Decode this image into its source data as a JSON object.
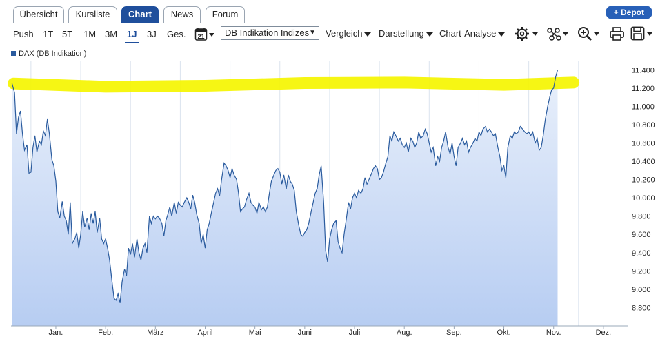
{
  "tabs": [
    {
      "label": "Übersicht"
    },
    {
      "label": "Kursliste"
    },
    {
      "label": "Chart"
    },
    {
      "label": "News"
    },
    {
      "label": "Forum"
    }
  ],
  "depot_button": "+ Depot",
  "periods": [
    "Push",
    "1T",
    "5T",
    "1M",
    "3M",
    "1J",
    "3J",
    "Ges."
  ],
  "active_period": "1J",
  "calendar_day": "21",
  "index_select": "DB Indikation Indizes",
  "menus": [
    "Vergleich",
    "Darstellung",
    "Chart-Analyse"
  ],
  "icons": [
    "gear-icon",
    "network-icon",
    "zoom-in-icon",
    "print-icon",
    "save-icon"
  ],
  "colors": {
    "accent": "#1f4f9c",
    "line": "#2a5b9e",
    "fill_top": "#e7eefb",
    "fill_bottom": "#b9cff3",
    "highlight": "#f5f500"
  },
  "chart_data": {
    "type": "area",
    "series": [
      {
        "name": "DAX (DB Indikation)"
      }
    ],
    "x_ticks": [
      "Jan.",
      "Feb.",
      "März",
      "April",
      "Mai",
      "Juni",
      "Juli",
      "Aug.",
      "Sep.",
      "Okt.",
      "Nov.",
      "Dez."
    ],
    "y_ticks": [
      "8.800",
      "9.000",
      "9.200",
      "9.400",
      "9.600",
      "9.800",
      "10.000",
      "10.200",
      "10.400",
      "10.600",
      "10.800",
      "11.000",
      "11.200",
      "11.400"
    ],
    "ylim": [
      8600,
      11500
    ],
    "grid": "vertical",
    "x_range_months": [
      -0.9,
      11.5
    ],
    "points": [
      [
        -0.88,
        11.25
      ],
      [
        -0.83,
        11.15
      ],
      [
        -0.79,
        10.7
      ],
      [
        -0.75,
        10.88
      ],
      [
        -0.71,
        10.95
      ],
      [
        -0.67,
        10.7
      ],
      [
        -0.63,
        10.52
      ],
      [
        -0.58,
        10.58
      ],
      [
        -0.54,
        10.27
      ],
      [
        -0.5,
        10.28
      ],
      [
        -0.46,
        10.55
      ],
      [
        -0.42,
        10.68
      ],
      [
        -0.38,
        10.5
      ],
      [
        -0.33,
        10.62
      ],
      [
        -0.29,
        10.58
      ],
      [
        -0.25,
        10.73
      ],
      [
        -0.21,
        10.68
      ],
      [
        -0.17,
        10.86
      ],
      [
        -0.13,
        10.7
      ],
      [
        -0.08,
        10.42
      ],
      [
        -0.04,
        10.35
      ],
      [
        0.0,
        10.18
      ],
      [
        0.04,
        9.85
      ],
      [
        0.08,
        9.78
      ],
      [
        0.13,
        9.96
      ],
      [
        0.17,
        9.8
      ],
      [
        0.21,
        9.75
      ],
      [
        0.25,
        9.6
      ],
      [
        0.29,
        9.95
      ],
      [
        0.33,
        9.5
      ],
      [
        0.38,
        9.55
      ],
      [
        0.42,
        9.62
      ],
      [
        0.46,
        9.45
      ],
      [
        0.5,
        9.6
      ],
      [
        0.54,
        9.85
      ],
      [
        0.58,
        9.68
      ],
      [
        0.63,
        9.78
      ],
      [
        0.67,
        9.65
      ],
      [
        0.71,
        9.83
      ],
      [
        0.75,
        9.72
      ],
      [
        0.79,
        9.85
      ],
      [
        0.83,
        9.62
      ],
      [
        0.88,
        9.78
      ],
      [
        0.92,
        9.55
      ],
      [
        0.96,
        9.5
      ],
      [
        1.0,
        9.55
      ],
      [
        1.04,
        9.45
      ],
      [
        1.08,
        9.32
      ],
      [
        1.13,
        9.08
      ],
      [
        1.17,
        8.9
      ],
      [
        1.21,
        8.88
      ],
      [
        1.25,
        8.95
      ],
      [
        1.29,
        8.85
      ],
      [
        1.33,
        9.08
      ],
      [
        1.38,
        9.22
      ],
      [
        1.42,
        9.15
      ],
      [
        1.46,
        9.45
      ],
      [
        1.5,
        9.38
      ],
      [
        1.54,
        9.5
      ],
      [
        1.58,
        9.35
      ],
      [
        1.63,
        9.55
      ],
      [
        1.67,
        9.4
      ],
      [
        1.71,
        9.32
      ],
      [
        1.75,
        9.45
      ],
      [
        1.79,
        9.5
      ],
      [
        1.83,
        9.4
      ],
      [
        1.88,
        9.8
      ],
      [
        1.92,
        9.72
      ],
      [
        1.96,
        9.8
      ],
      [
        2.0,
        9.77
      ],
      [
        2.04,
        9.8
      ],
      [
        2.08,
        9.78
      ],
      [
        2.13,
        9.72
      ],
      [
        2.17,
        9.58
      ],
      [
        2.21,
        9.75
      ],
      [
        2.25,
        9.82
      ],
      [
        2.29,
        9.9
      ],
      [
        2.33,
        9.8
      ],
      [
        2.38,
        9.95
      ],
      [
        2.42,
        9.83
      ],
      [
        2.46,
        9.95
      ],
      [
        2.5,
        9.92
      ],
      [
        2.54,
        9.9
      ],
      [
        2.58,
        9.95
      ],
      [
        2.63,
        10.0
      ],
      [
        2.67,
        9.95
      ],
      [
        2.71,
        9.88
      ],
      [
        2.75,
        10.03
      ],
      [
        2.79,
        9.95
      ],
      [
        2.83,
        9.82
      ],
      [
        2.88,
        9.72
      ],
      [
        2.92,
        9.5
      ],
      [
        2.96,
        9.6
      ],
      [
        3.0,
        9.45
      ],
      [
        3.04,
        9.65
      ],
      [
        3.08,
        9.72
      ],
      [
        3.13,
        9.85
      ],
      [
        3.17,
        9.95
      ],
      [
        3.21,
        10.05
      ],
      [
        3.25,
        10.1
      ],
      [
        3.29,
        10.02
      ],
      [
        3.33,
        10.2
      ],
      [
        3.38,
        10.38
      ],
      [
        3.42,
        10.35
      ],
      [
        3.46,
        10.3
      ],
      [
        3.5,
        10.22
      ],
      [
        3.54,
        10.32
      ],
      [
        3.58,
        10.25
      ],
      [
        3.63,
        10.2
      ],
      [
        3.67,
        10.05
      ],
      [
        3.71,
        9.85
      ],
      [
        3.75,
        9.88
      ],
      [
        3.79,
        9.9
      ],
      [
        3.83,
        9.98
      ],
      [
        3.88,
        10.05
      ],
      [
        3.92,
        9.95
      ],
      [
        3.96,
        9.92
      ],
      [
        4.0,
        9.9
      ],
      [
        4.04,
        9.83
      ],
      [
        4.08,
        9.95
      ],
      [
        4.13,
        9.87
      ],
      [
        4.17,
        9.9
      ],
      [
        4.21,
        9.85
      ],
      [
        4.25,
        9.9
      ],
      [
        4.29,
        10.05
      ],
      [
        4.33,
        10.18
      ],
      [
        4.38,
        10.25
      ],
      [
        4.42,
        10.3
      ],
      [
        4.46,
        10.32
      ],
      [
        4.5,
        10.28
      ],
      [
        4.54,
        10.15
      ],
      [
        4.58,
        10.25
      ],
      [
        4.63,
        10.1
      ],
      [
        4.67,
        10.25
      ],
      [
        4.71,
        10.18
      ],
      [
        4.75,
        10.15
      ],
      [
        4.79,
        10.08
      ],
      [
        4.83,
        9.85
      ],
      [
        4.88,
        9.7
      ],
      [
        4.92,
        9.6
      ],
      [
        4.96,
        9.58
      ],
      [
        5.0,
        9.62
      ],
      [
        5.04,
        9.65
      ],
      [
        5.08,
        9.72
      ],
      [
        5.13,
        9.85
      ],
      [
        5.17,
        9.95
      ],
      [
        5.21,
        10.05
      ],
      [
        5.25,
        10.1
      ],
      [
        5.29,
        10.25
      ],
      [
        5.33,
        10.35
      ],
      [
        5.38,
        9.95
      ],
      [
        5.42,
        9.42
      ],
      [
        5.46,
        9.3
      ],
      [
        5.5,
        9.55
      ],
      [
        5.54,
        9.65
      ],
      [
        5.58,
        9.72
      ],
      [
        5.63,
        9.75
      ],
      [
        5.67,
        9.52
      ],
      [
        5.71,
        9.45
      ],
      [
        5.75,
        9.4
      ],
      [
        5.79,
        9.6
      ],
      [
        5.83,
        9.75
      ],
      [
        5.88,
        9.95
      ],
      [
        5.92,
        9.88
      ],
      [
        5.96,
        10.0
      ],
      [
        6.0,
        10.05
      ],
      [
        6.04,
        10.0
      ],
      [
        6.08,
        10.08
      ],
      [
        6.13,
        10.05
      ],
      [
        6.17,
        10.1
      ],
      [
        6.21,
        10.22
      ],
      [
        6.25,
        10.15
      ],
      [
        6.29,
        10.2
      ],
      [
        6.33,
        10.25
      ],
      [
        6.38,
        10.32
      ],
      [
        6.42,
        10.35
      ],
      [
        6.46,
        10.32
      ],
      [
        6.5,
        10.2
      ],
      [
        6.54,
        10.22
      ],
      [
        6.58,
        10.28
      ],
      [
        6.63,
        10.38
      ],
      [
        6.67,
        10.45
      ],
      [
        6.71,
        10.68
      ],
      [
        6.75,
        10.62
      ],
      [
        6.79,
        10.72
      ],
      [
        6.83,
        10.68
      ],
      [
        6.88,
        10.62
      ],
      [
        6.92,
        10.65
      ],
      [
        6.96,
        10.58
      ],
      [
        7.0,
        10.55
      ],
      [
        7.04,
        10.6
      ],
      [
        7.08,
        10.5
      ],
      [
        7.13,
        10.65
      ],
      [
        7.17,
        10.62
      ],
      [
        7.21,
        10.55
      ],
      [
        7.25,
        10.6
      ],
      [
        7.29,
        10.72
      ],
      [
        7.33,
        10.65
      ],
      [
        7.38,
        10.68
      ],
      [
        7.42,
        10.75
      ],
      [
        7.46,
        10.7
      ],
      [
        7.5,
        10.6
      ],
      [
        7.54,
        10.5
      ],
      [
        7.58,
        10.55
      ],
      [
        7.63,
        10.35
      ],
      [
        7.67,
        10.45
      ],
      [
        7.71,
        10.4
      ],
      [
        7.75,
        10.55
      ],
      [
        7.79,
        10.62
      ],
      [
        7.83,
        10.72
      ],
      [
        7.88,
        10.55
      ],
      [
        7.92,
        10.48
      ],
      [
        7.96,
        10.6
      ],
      [
        8.0,
        10.45
      ],
      [
        8.04,
        10.35
      ],
      [
        8.08,
        10.55
      ],
      [
        8.13,
        10.6
      ],
      [
        8.17,
        10.65
      ],
      [
        8.21,
        10.58
      ],
      [
        8.25,
        10.62
      ],
      [
        8.29,
        10.5
      ],
      [
        8.33,
        10.55
      ],
      [
        8.38,
        10.6
      ],
      [
        8.42,
        10.65
      ],
      [
        8.46,
        10.62
      ],
      [
        8.5,
        10.72
      ],
      [
        8.54,
        10.68
      ],
      [
        8.58,
        10.75
      ],
      [
        8.63,
        10.78
      ],
      [
        8.67,
        10.72
      ],
      [
        8.71,
        10.75
      ],
      [
        8.75,
        10.72
      ],
      [
        8.79,
        10.68
      ],
      [
        8.83,
        10.7
      ],
      [
        8.88,
        10.55
      ],
      [
        8.92,
        10.45
      ],
      [
        8.96,
        10.3
      ],
      [
        9.0,
        10.35
      ],
      [
        9.04,
        10.22
      ],
      [
        9.08,
        10.55
      ],
      [
        9.13,
        10.68
      ],
      [
        9.17,
        10.65
      ],
      [
        9.21,
        10.72
      ],
      [
        9.25,
        10.7
      ],
      [
        9.29,
        10.72
      ],
      [
        9.33,
        10.78
      ],
      [
        9.38,
        10.75
      ],
      [
        9.42,
        10.72
      ],
      [
        9.46,
        10.7
      ],
      [
        9.5,
        10.72
      ],
      [
        9.54,
        10.68
      ],
      [
        9.58,
        10.72
      ],
      [
        9.63,
        10.6
      ],
      [
        9.67,
        10.65
      ],
      [
        9.71,
        10.52
      ],
      [
        9.75,
        10.55
      ],
      [
        9.79,
        10.68
      ],
      [
        9.83,
        10.85
      ],
      [
        9.88,
        11.0
      ],
      [
        9.92,
        11.1
      ],
      [
        9.96,
        11.18
      ],
      [
        10.0,
        11.2
      ],
      [
        10.04,
        11.32
      ],
      [
        10.08,
        11.4
      ]
    ]
  }
}
